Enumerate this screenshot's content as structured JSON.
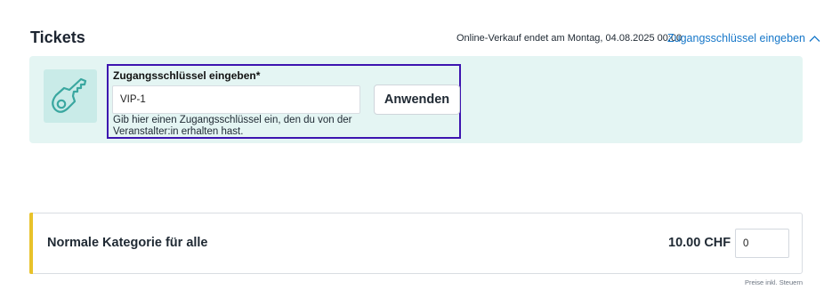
{
  "tickets": {
    "title": "Tickets",
    "sale_end": "Online-Verkauf endet am Montag, 04.08.2025 00:00",
    "access_toggle_label": "Zugangsschlüssel eingeben"
  },
  "access_key": {
    "label": "Zugangsschlüssel eingeben*",
    "value": "VIP-1",
    "apply_label": "Anwenden",
    "helper_text": "Gib hier einen Zugangsschlüssel ein, den du von der Veranstalter:in erhalten hast.",
    "icon": "key-icon"
  },
  "ticket_category": {
    "name": "Normale Kategorie für alle",
    "price": "10.00 CHF",
    "quantity": "0"
  },
  "footer": {
    "tax_note": "Preise inkl. Steuern"
  },
  "colors": {
    "link": "#1677c9",
    "panel_bg": "#e4f5f3",
    "focus_frame": "#3d14b0",
    "category_accent": "#e8c22a"
  }
}
